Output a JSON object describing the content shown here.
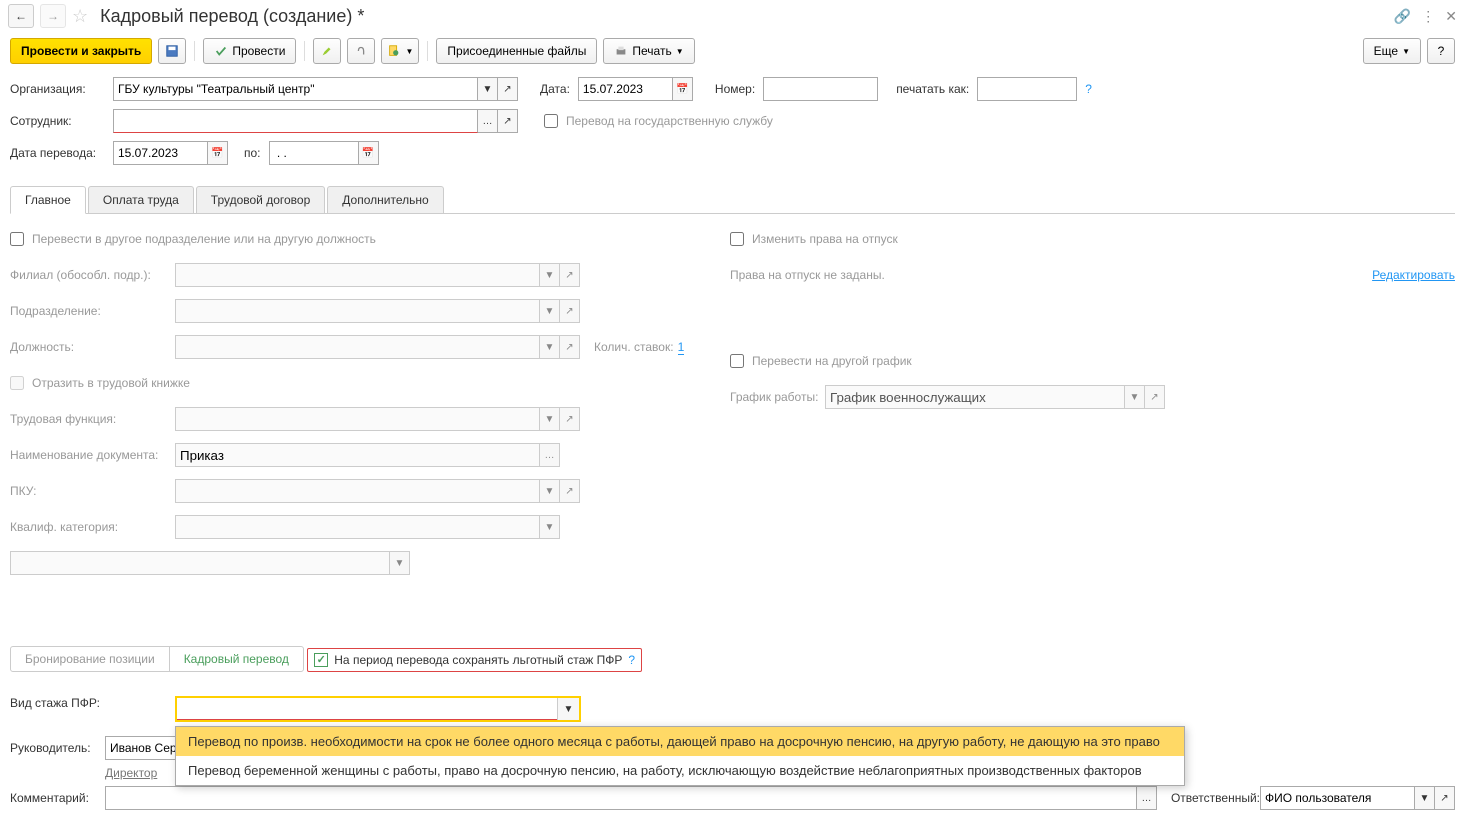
{
  "title": "Кадровый перевод (создание) *",
  "toolbar": {
    "post_close": "Провести и закрыть",
    "post": "Провести",
    "attached_files": "Присоединенные файлы",
    "print": "Печать",
    "more": "Еще"
  },
  "header": {
    "org_label": "Организация:",
    "org_value": "ГБУ культуры \"Театральный центр\"",
    "date_label": "Дата:",
    "date_value": "15.07.2023",
    "number_label": "Номер:",
    "print_as_label": "печатать как:",
    "employee_label": "Сотрудник:",
    "gov_service_label": "Перевод на государственную службу",
    "transfer_date_label": "Дата перевода:",
    "transfer_date_value": "15.07.2023",
    "to_label": "по:",
    "to_value": " . ."
  },
  "tabs": [
    "Главное",
    "Оплата труда",
    "Трудовой договор",
    "Дополнительно"
  ],
  "main": {
    "transfer_other_label": "Перевести в другое подразделение или на другую должность",
    "branch_label": "Филиал (обособл. подр.):",
    "dept_label": "Подразделение:",
    "position_label": "Должность:",
    "rates_label": "Колич. ставок:",
    "rates_value": "1",
    "book_label": "Отразить в трудовой книжке",
    "func_label": "Трудовая функция:",
    "doc_name_label": "Наименование документа:",
    "doc_name_value": "Приказ",
    "pku_label": "ПКУ:",
    "qual_label": "Квалиф. категория:",
    "change_vacation_label": "Изменить права на отпуск",
    "vacation_text": "Права на отпуск не заданы.",
    "edit_link": "Редактировать",
    "transfer_schedule_label": "Перевести на другой график",
    "schedule_label": "График работы:",
    "schedule_value": "График военнослужащих"
  },
  "sub_tabs": [
    "Бронирование позиции",
    "Кадровый перевод"
  ],
  "pfr": {
    "checkbox_label": "На период перевода сохранять льготный стаж ПФР",
    "type_label": "Вид стажа ПФР:",
    "options": [
      "Перевод по произв. необходимости на срок не более одного месяца с работы, дающей право на досрочную пенсию, на другую работу, не дающую на это право",
      "Перевод беременной женщины с работы, право на досрочную пенсию, на работу, исключающую воздействие неблагоприятных производственных факторов"
    ]
  },
  "footer": {
    "manager_label": "Руководитель:",
    "manager_value": "Иванов Сергей Петрович",
    "position_link": "Директор",
    "comment_label": "Комментарий:",
    "responsible_label": "Ответственный:",
    "responsible_value": "ФИО пользователя"
  }
}
